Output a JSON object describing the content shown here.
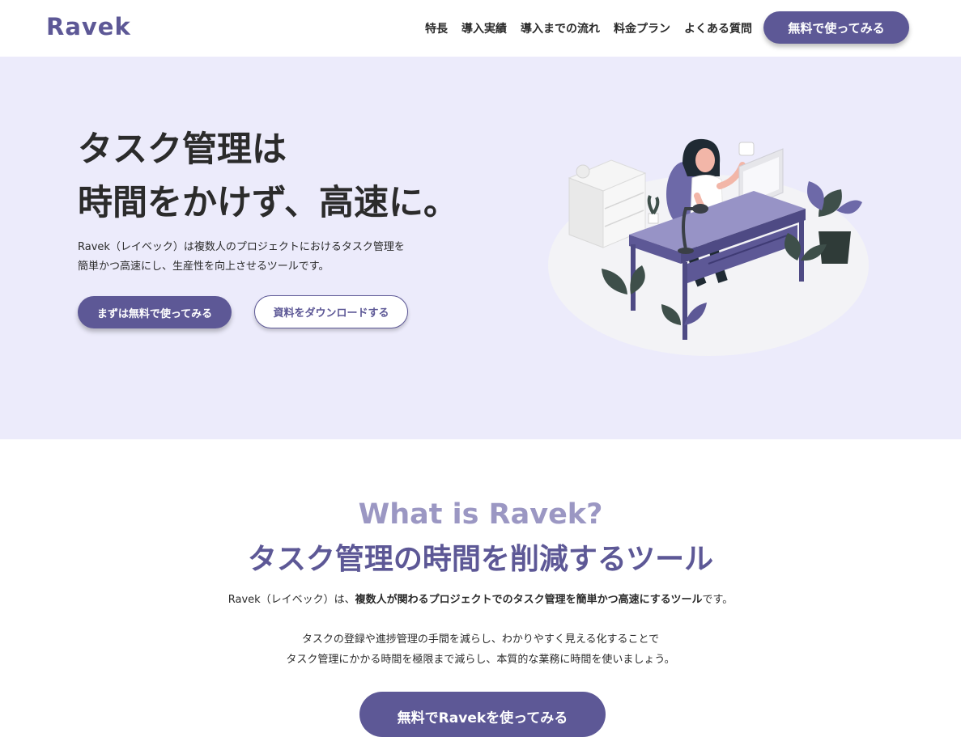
{
  "header": {
    "logo": "Ravek",
    "nav": [
      "特長",
      "導入実績",
      "導入までの流れ",
      "料金プラン",
      "よくある質問"
    ],
    "cta": "無料で使ってみる"
  },
  "hero": {
    "title_line1": "タスク管理は",
    "title_line2": "時間をかけず、高速に。",
    "desc_line1": "Ravek（レイベック）は複数人のプロジェクトにおけるタスク管理を",
    "desc_line2": "簡単かつ高速にし、生産性を向上させるツールです。",
    "primary_button": "まずは無料で使ってみる",
    "secondary_button": "資料をダウンロードする"
  },
  "about": {
    "heading_en": "What is Ravek?",
    "heading_jp": "タスク管理の時間を削減するツール",
    "line1_pre": "Ravek（レイベック）は、",
    "line1_bold": "複数人が関わるプロジェクトでのタスク管理を簡単かつ高速にするツール",
    "line1_post": "です。",
    "para_line1": "タスクの登録や進捗管理の手間を減らし、わかりやすく見える化することで",
    "para_line2": "タスク管理にかかる時間を極限まで減らし、本質的な業務に時間を使いましょう。",
    "cta": "無料でRavekを使ってみる"
  },
  "colors": {
    "brand": "#5d5896",
    "brand_light": "#9b97c3",
    "hero_bg": "#ecebfb",
    "text": "#2b2b2b"
  }
}
